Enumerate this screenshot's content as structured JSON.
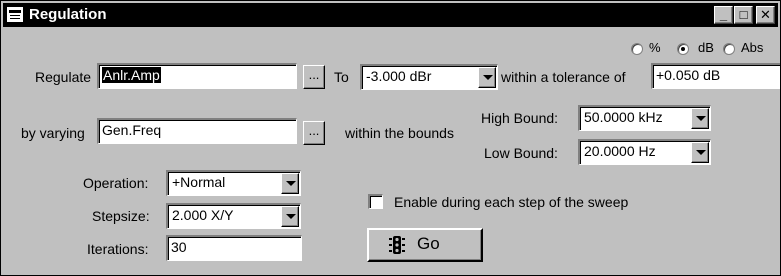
{
  "window": {
    "title": "Regulation"
  },
  "caption_buttons": {
    "minimize": "_",
    "maximize": "□",
    "close": "✕"
  },
  "units_radio": {
    "options": [
      {
        "label": "%",
        "selected": false
      },
      {
        "label": "dB",
        "selected": true
      },
      {
        "label": "Abs",
        "selected": false
      }
    ]
  },
  "regulate": {
    "label": "Regulate",
    "value": "Anlr.Amp",
    "browse_label": "...",
    "to_label": "To",
    "target": "-3.000  dBr",
    "tolerance_label": "within a tolerance of",
    "tolerance": "+0.050  dB"
  },
  "varying": {
    "label": "by varying",
    "value": "Gen.Freq",
    "browse_label": "...",
    "bounds_label": "within the bounds",
    "high_label": "High Bound:",
    "high_value": "50.0000 kHz",
    "low_label": "Low Bound:",
    "low_value": "20.0000  Hz"
  },
  "operation": {
    "label": "Operation:",
    "value": "+Normal"
  },
  "stepsize": {
    "label": "Stepsize:",
    "value": "2.000   X/Y"
  },
  "iterations": {
    "label": "Iterations:",
    "value": "30"
  },
  "sweep_checkbox": {
    "label": "Enable during each step of the sweep",
    "checked": false
  },
  "go_button": {
    "label": "Go",
    "icon": "traffic-light-icon"
  }
}
